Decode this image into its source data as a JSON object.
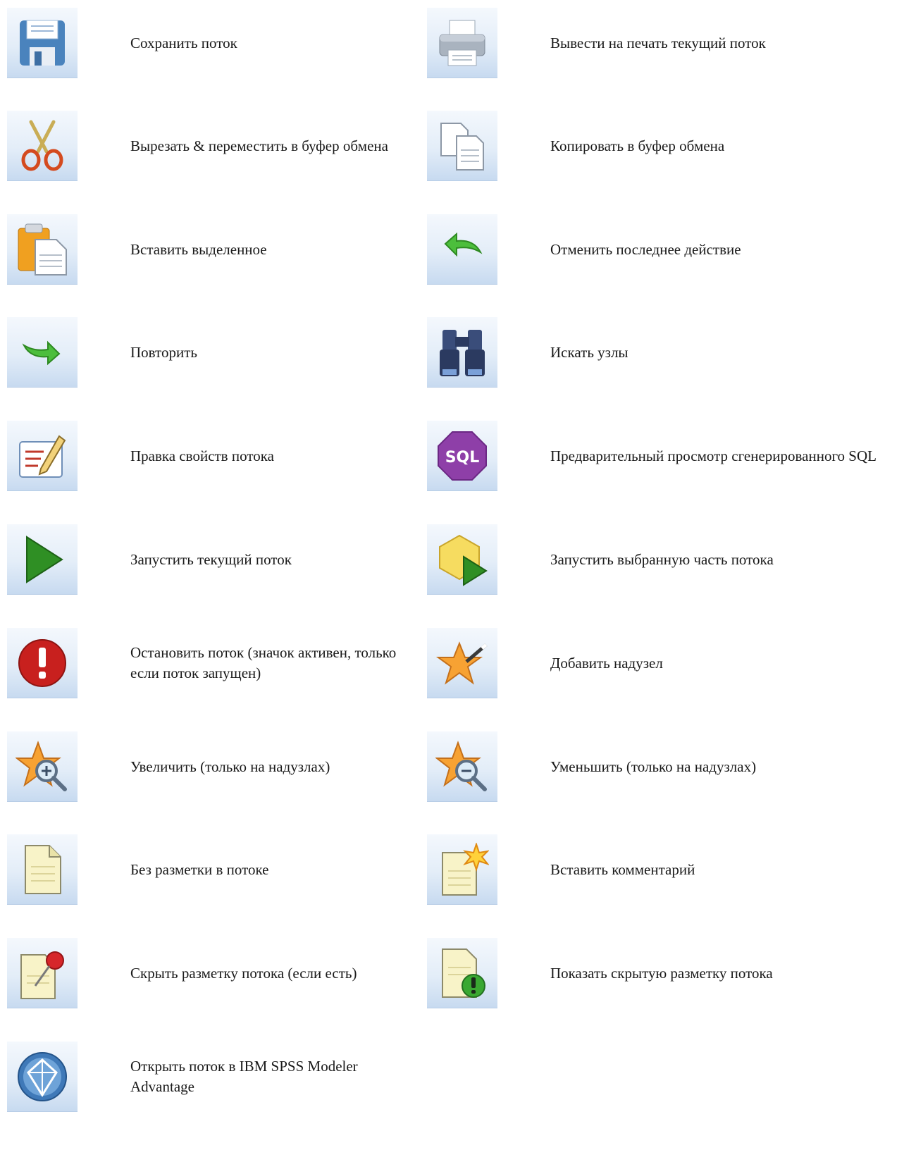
{
  "items": [
    {
      "label": "Сохранить поток",
      "icon": "save-icon"
    },
    {
      "label": "Вывести на печать текущий поток",
      "icon": "print-icon"
    },
    {
      "label": "Вырезать & переместить в буфер обмена",
      "icon": "scissors-icon"
    },
    {
      "label": "Копировать в буфер обмена",
      "icon": "copy-icon"
    },
    {
      "label": "Вставить выделенное",
      "icon": "paste-icon"
    },
    {
      "label": "Отменить последнее действие",
      "icon": "undo-icon"
    },
    {
      "label": "Повторить",
      "icon": "redo-icon"
    },
    {
      "label": "Искать узлы",
      "icon": "binoculars-icon"
    },
    {
      "label": "Правка свойств потока",
      "icon": "edit-properties-icon"
    },
    {
      "label": "Предварительный просмотр сгенерированного SQL",
      "icon": "sql-icon"
    },
    {
      "label": "Запустить текущий поток",
      "icon": "play-icon"
    },
    {
      "label": "Запустить выбранную часть потока",
      "icon": "run-selection-icon"
    },
    {
      "label": "Остановить поток (значок активен, только если поток запущен)",
      "icon": "stop-icon"
    },
    {
      "label": "Добавить надузел",
      "icon": "add-supernode-icon"
    },
    {
      "label": "Увеличить (только на надузлах)",
      "icon": "zoom-in-icon"
    },
    {
      "label": "Уменьшить (только на надузлах)",
      "icon": "zoom-out-icon"
    },
    {
      "label": "Без разметки в потоке",
      "icon": "blank-document-icon"
    },
    {
      "label": "Вставить комментарий",
      "icon": "insert-comment-icon"
    },
    {
      "label": "Скрыть разметку потока (если есть)",
      "icon": "pin-document-icon"
    },
    {
      "label": "Показать скрытую разметку потока",
      "icon": "show-markup-icon"
    },
    {
      "label": "Открыть поток в IBM SPSS Modeler Advantage",
      "icon": "modeler-advantage-icon"
    }
  ]
}
